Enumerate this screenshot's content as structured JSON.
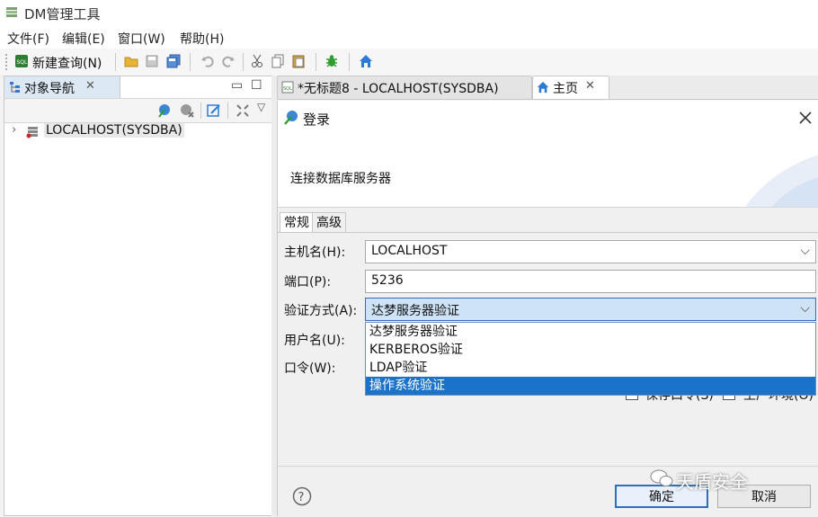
{
  "window": {
    "title": "DM管理工具"
  },
  "menu": [
    "文件(F)",
    "编辑(E)",
    "窗口(W)",
    "帮助(H)"
  ],
  "toolbar": {
    "new_query_label": "新建查询(N)"
  },
  "navigator": {
    "tab_label": "对象导航",
    "tree": [
      {
        "label": "LOCALHOST(SYSDBA)"
      }
    ]
  },
  "editor_tabs": [
    {
      "label": "*无标题8 - LOCALHOST(SYSDBA)",
      "active": false
    },
    {
      "label": "主页",
      "active": true
    }
  ],
  "dialog": {
    "title": "登录",
    "subtitle": "连接数据库服务器",
    "tabs": [
      "常规",
      "高级"
    ],
    "fields": {
      "host_label": "主机名(H):",
      "host_value": "LOCALHOST",
      "port_label": "端口(P):",
      "port_value": "5236",
      "auth_label": "验证方式(A):",
      "auth_value": "达梦服务器验证",
      "user_label": "用户名(U):",
      "password_label": "口令(W):"
    },
    "auth_options": [
      "达梦服务器验证",
      "KERBEROS验证",
      "LDAP验证",
      "操作系统验证"
    ],
    "auth_highlighted_index": 3,
    "save_password_label": "保存口令(S)",
    "production_env_label": "生产环境(O)",
    "ok_label": "确定",
    "cancel_label": "取消"
  },
  "watermark": "天盾安全",
  "colors": {
    "selection": "#1a73c8",
    "focus": "#2d6fb8",
    "icon_blue": "#2b7bd6",
    "icon_green": "#2f9e2f"
  }
}
